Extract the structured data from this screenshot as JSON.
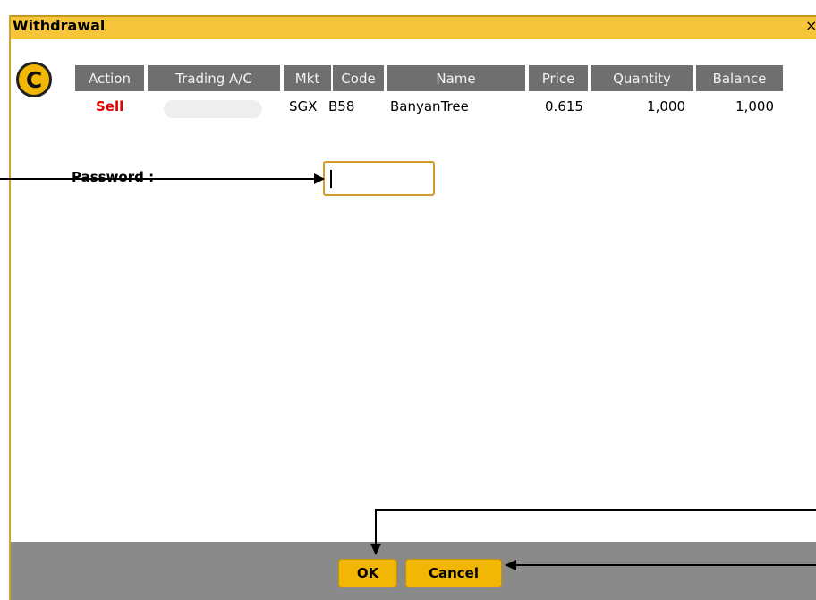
{
  "window": {
    "title": "Withdrawal",
    "close_symbol": "×",
    "logo_letter": "C"
  },
  "order_table": {
    "columns": [
      "Action",
      "Trading A/C",
      "Mkt",
      "Code",
      "Name",
      "Price",
      "Quantity",
      "Balance"
    ],
    "row": {
      "action": "Sell",
      "trading_ac": "",
      "mkt": "SGX",
      "code": "B58",
      "name": "BanyanTree",
      "price": "0.615",
      "quantity": "1,000",
      "balance": "1,000"
    },
    "action_color": "#e00000"
  },
  "form": {
    "password_label": "Password :",
    "password_value": ""
  },
  "buttons": {
    "ok_label": "OK",
    "cancel_label": "Cancel"
  },
  "colors": {
    "title_bar": "#f7c53a",
    "button": "#f2b705",
    "header": "#6f6f6f",
    "footer": "#8a8a8a"
  }
}
